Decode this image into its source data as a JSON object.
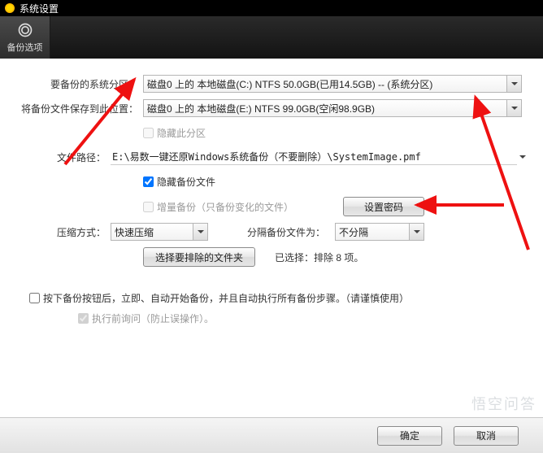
{
  "window": {
    "title": "系统设置"
  },
  "tab": {
    "label": "备份选项"
  },
  "form": {
    "source_label": "要备份的系统分区：",
    "source_value": "磁盘0 上的 本地磁盘(C:) NTFS 50.0GB(已用14.5GB) -- (系统分区)",
    "target_label": "将备份文件保存到此位置：",
    "target_value": "磁盘0 上的 本地磁盘(E:) NTFS 99.0GB(空闲98.9GB)",
    "hide_partition_label": "隐藏此分区",
    "filepath_label": "文件路径：",
    "filepath_value": "E:\\易数一键还原Windows系统备份（不要删除）\\SystemImage.pmf",
    "hide_backup_label": "隐藏备份文件",
    "incremental_label": "增量备份（只备份变化的文件）",
    "password_btn": "设置密码",
    "compress_label": "压缩方式：",
    "compress_value": "快速压缩",
    "split_label": "分隔备份文件为：",
    "split_value": "不分隔",
    "exclude_btn": "选择要排除的文件夹",
    "exclude_status": "已选择：排除 8 项。"
  },
  "auto": {
    "main_label": "按下备份按钮后，立即、自动开始备份，并且自动执行所有备份步骤。（请谨慎使用）",
    "sub_label": "执行前询问（防止误操作）。"
  },
  "footer": {
    "ok": "确定",
    "cancel": "取消"
  }
}
